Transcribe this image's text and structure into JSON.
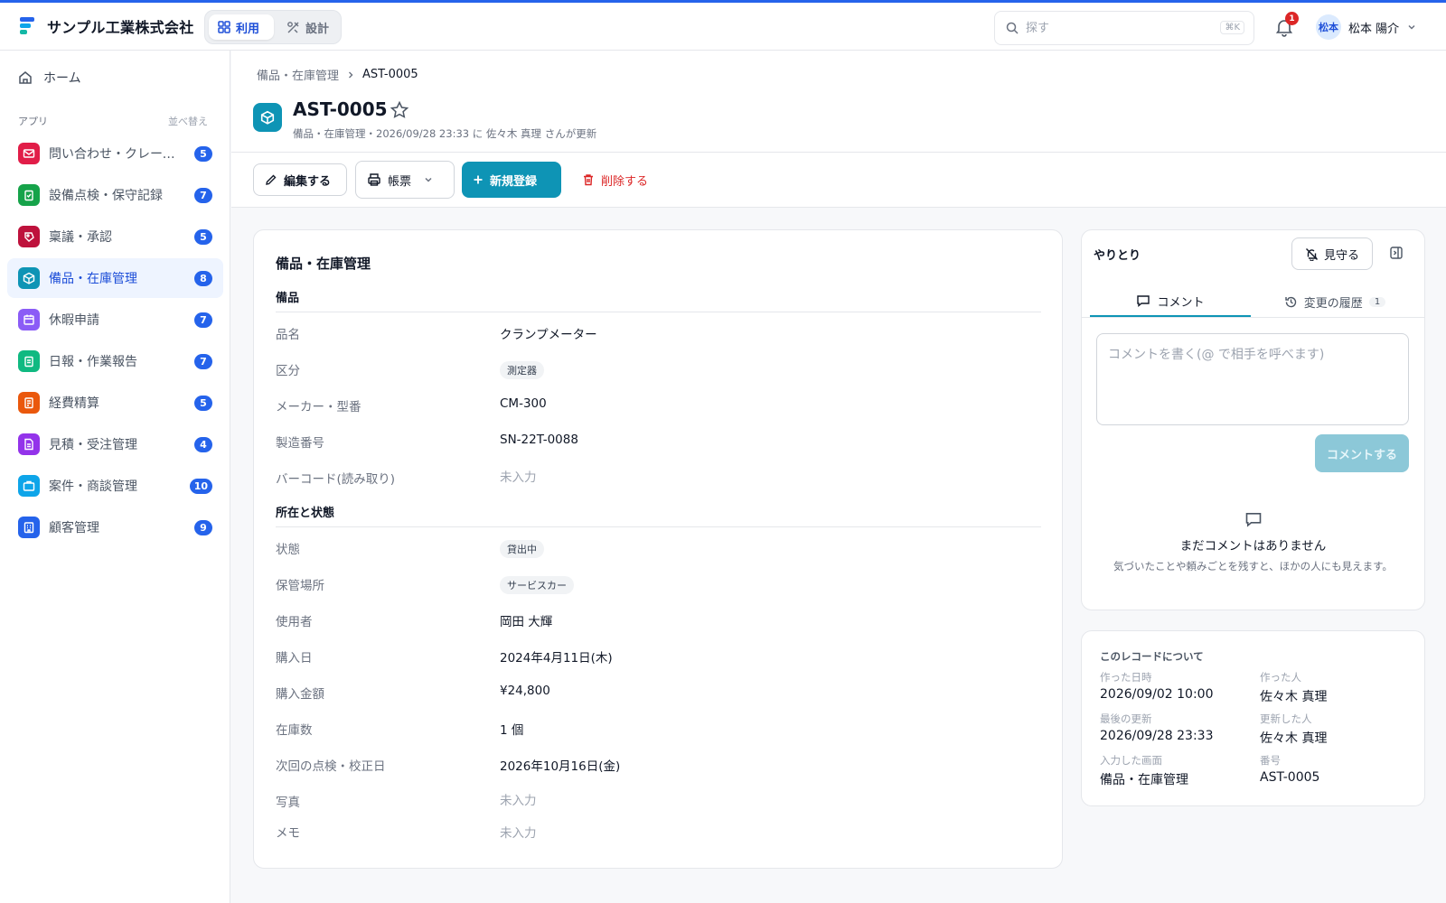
{
  "header": {
    "company": "サンプル工業株式会社",
    "mode_use": "利用",
    "mode_design": "設計",
    "search_placeholder": "探す",
    "search_shortcut": "⌘K",
    "notification_count": "1",
    "user_initials": "松本",
    "user_name": "松本 陽介"
  },
  "sidebar": {
    "home": "ホーム",
    "apps_heading": "アプリ",
    "sort_label": "並べ替え",
    "apps": [
      {
        "label": "問い合わせ・クレーム管理",
        "count": "5",
        "color": "#e11d48",
        "icon": "mail-icon"
      },
      {
        "label": "設備点検・保守記録",
        "count": "7",
        "color": "#16a34a",
        "icon": "clipboard-check-icon"
      },
      {
        "label": "稟議・承認",
        "count": "5",
        "color": "#be123c",
        "icon": "stamp-icon"
      },
      {
        "label": "備品・在庫管理",
        "count": "8",
        "color": "#0e94b5",
        "icon": "box-icon"
      },
      {
        "label": "休暇申請",
        "count": "7",
        "color": "#8b5cf6",
        "icon": "calendar-icon"
      },
      {
        "label": "日報・作業報告",
        "count": "7",
        "color": "#10b981",
        "icon": "clipboard-icon"
      },
      {
        "label": "経費精算",
        "count": "5",
        "color": "#ea580c",
        "icon": "receipt-icon"
      },
      {
        "label": "見積・受注管理",
        "count": "4",
        "color": "#9333ea",
        "icon": "document-icon"
      },
      {
        "label": "案件・商談管理",
        "count": "10",
        "color": "#0ea5e9",
        "icon": "briefcase-icon"
      },
      {
        "label": "顧客管理",
        "count": "9",
        "color": "#2563eb",
        "icon": "building-icon"
      }
    ]
  },
  "record": {
    "breadcrumb_parent": "備品・在庫管理",
    "breadcrumb_current": "AST-0005",
    "title": "AST-0005",
    "subtitle": "備品・在庫管理・2026/09/28 23:33 に 佐々木 真理 さんが更新"
  },
  "toolbar": {
    "edit": "編集する",
    "print": "帳票",
    "new": "新規登録",
    "delete": "削除する"
  },
  "form": {
    "title": "備品・在庫管理",
    "section1": "備品",
    "section2": "所在と状態",
    "fields": {
      "name_label": "品名",
      "name_value": "クランプメーター",
      "category_label": "区分",
      "category_value": "測定器",
      "maker_label": "メーカー・型番",
      "maker_value": "CM-300",
      "serial_label": "製造番号",
      "serial_value": "SN-22T-0088",
      "barcode_label": "バーコード(読み取り)",
      "barcode_value": "未入力",
      "status_label": "状態",
      "status_value": "貸出中",
      "location_label": "保管場所",
      "location_value": "サービスカー",
      "user_label": "使用者",
      "user_value": "岡田 大輝",
      "purchase_date_label": "購入日",
      "purchase_date_value": "2024年4月11日(木)",
      "price_label": "購入金額",
      "price_value": "¥24,800",
      "stock_label": "在庫数",
      "stock_value": "1 個",
      "next_check_label": "次回の点検・校正日",
      "next_check_value": "2026年10月16日(金)",
      "photo_label": "写真",
      "photo_value": "未入力",
      "memo_label": "メモ",
      "memo_value": "未入力"
    }
  },
  "panel": {
    "title": "やりとり",
    "watch": "見守る",
    "tab_comment": "コメント",
    "tab_history": "変更の履歴",
    "history_count": "1",
    "comment_placeholder": "コメントを書く(@ で相手を呼べます)",
    "submit": "コメントする",
    "empty_title": "まだコメントはありません",
    "empty_desc": "気づいたことや頼みごとを残すと、ほかの人にも見えます。"
  },
  "meta": {
    "title": "このレコードについて",
    "created_label": "作った日時",
    "created_value": "2026/09/02 10:00",
    "creator_label": "作った人",
    "creator_value": "佐々木 真理",
    "updated_label": "最後の更新",
    "updated_value": "2026/09/28 23:33",
    "updater_label": "更新した人",
    "updater_value": "佐々木 真理",
    "screen_label": "入力した画面",
    "screen_value": "備品・在庫管理",
    "number_label": "番号",
    "number_value": "AST-0005"
  }
}
